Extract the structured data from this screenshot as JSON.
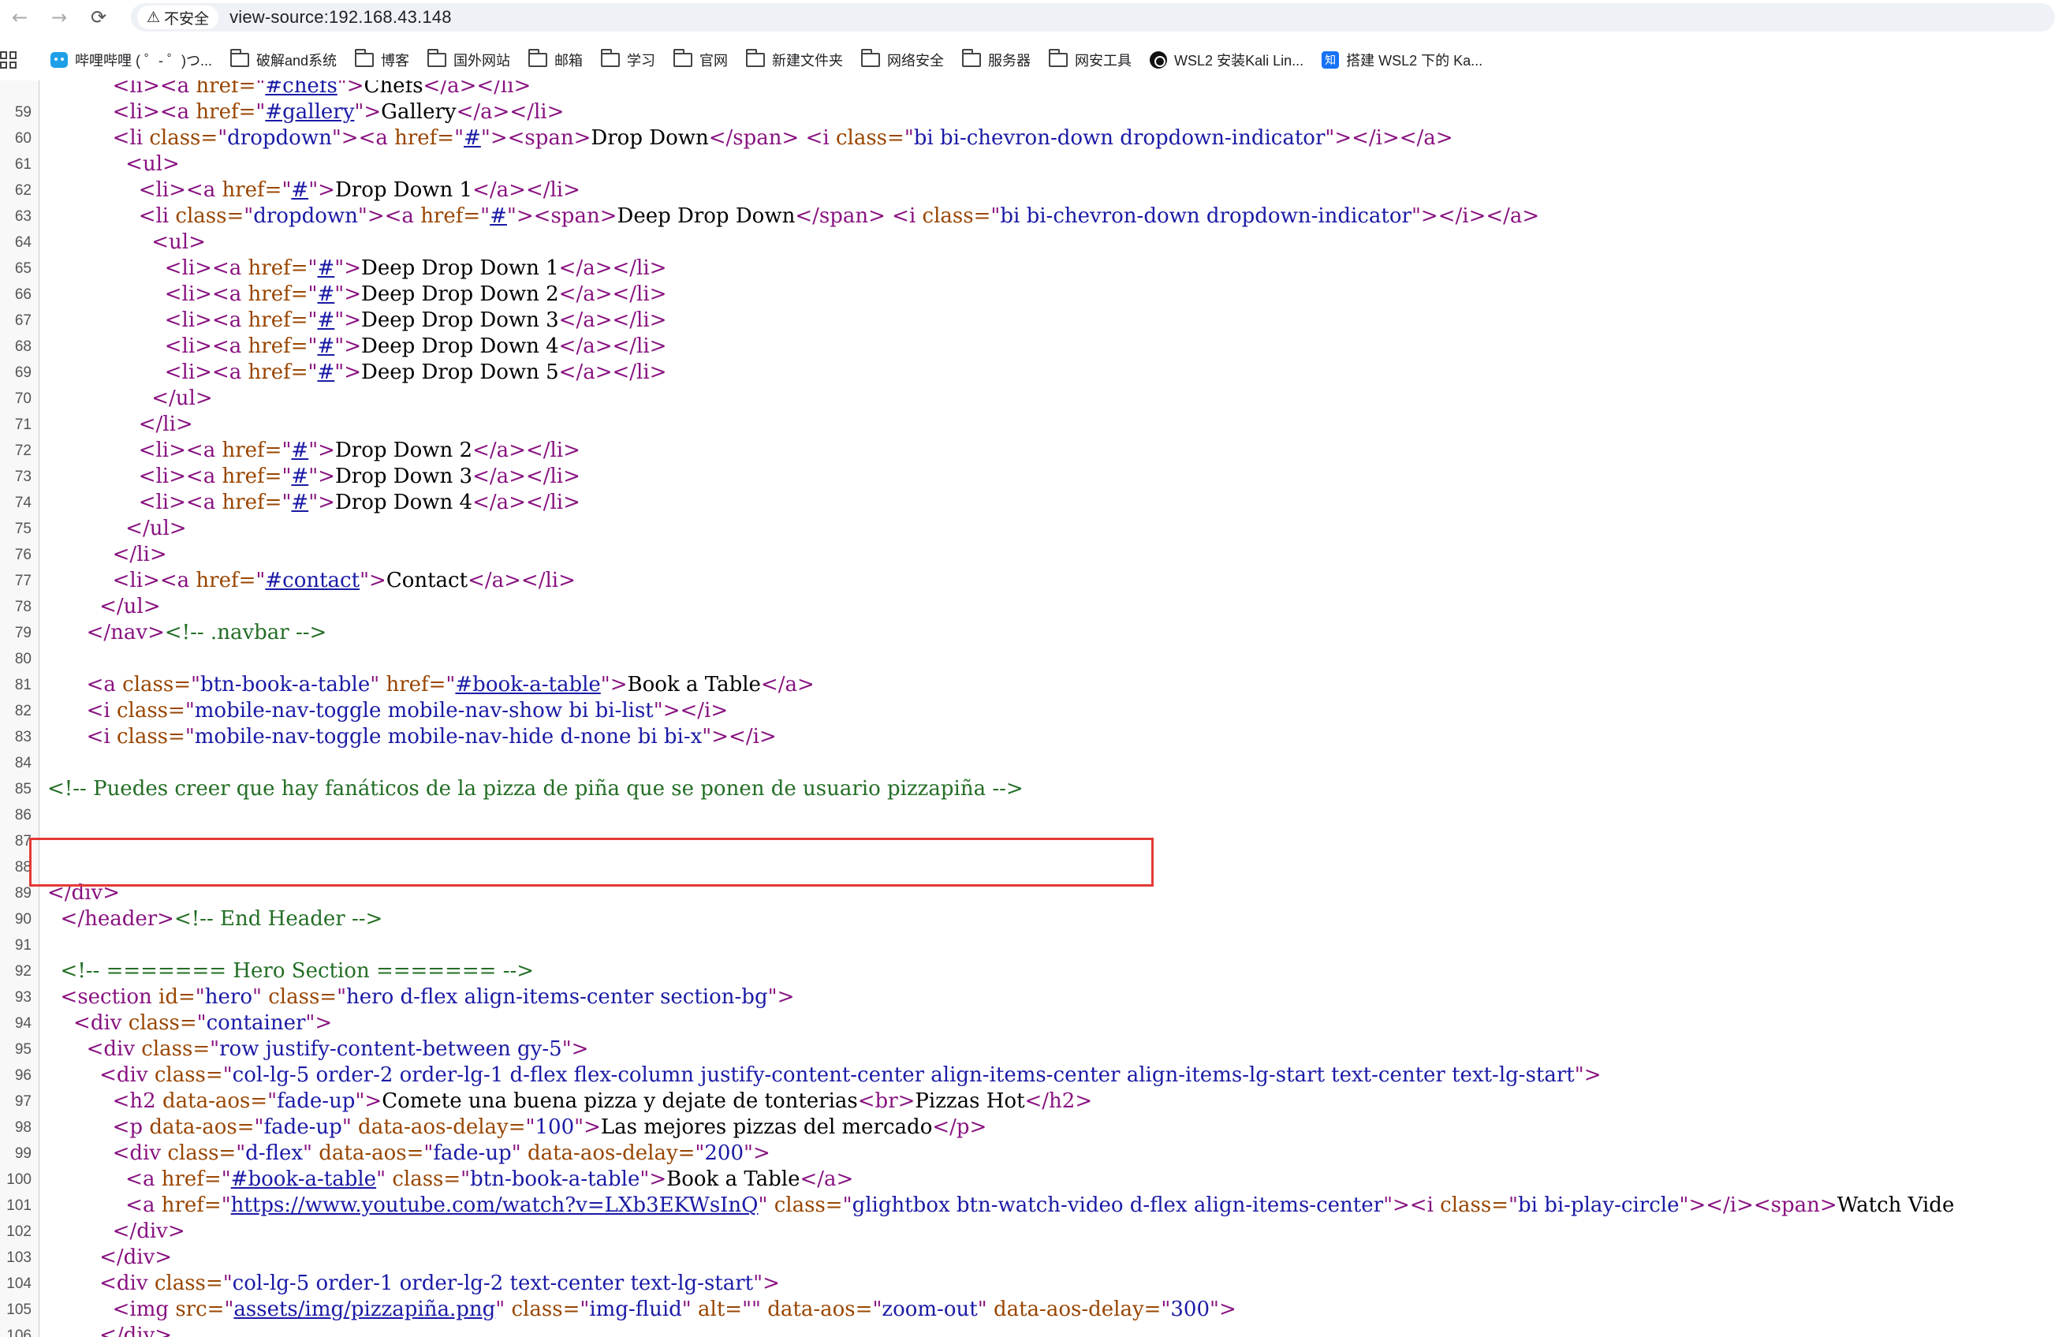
{
  "toolbar": {
    "back_icon": "←",
    "forward_icon": "→",
    "reload_icon": "⟳"
  },
  "address_bar": {
    "security_icon": "⚠",
    "security_label": "不安全",
    "url": "view-source:192.168.43.148"
  },
  "bookmarks": [
    {
      "label": "哔哩哔哩 ( ゜- ゜)つ...",
      "icon": "bilibili-icon"
    },
    {
      "label": "破解and系统",
      "icon": "folder-icon"
    },
    {
      "label": "博客",
      "icon": "folder-icon"
    },
    {
      "label": "国外网站",
      "icon": "folder-icon"
    },
    {
      "label": "邮箱",
      "icon": "folder-icon"
    },
    {
      "label": "学习",
      "icon": "folder-icon"
    },
    {
      "label": "官网",
      "icon": "folder-icon"
    },
    {
      "label": "新建文件夹",
      "icon": "folder-icon"
    },
    {
      "label": "网络安全",
      "icon": "folder-icon"
    },
    {
      "label": "服务器",
      "icon": "folder-icon"
    },
    {
      "label": "网安工具",
      "icon": "folder-icon"
    },
    {
      "label": "WSL2 安装Kali Lin...",
      "icon": "circle-icon"
    },
    {
      "label": "搭建 WSL2 下的 Ka...",
      "icon": "zhihu-icon"
    }
  ],
  "source_lines": [
    {
      "n": "",
      "seg": [
        [
          "t",
          "          <li><a "
        ],
        [
          "a",
          "href="
        ],
        [
          "t",
          "\""
        ],
        [
          "k",
          "#chefs"
        ],
        [
          "t",
          "\">"
        ],
        [
          "x",
          "Chefs"
        ],
        [
          "t",
          "</a></li>"
        ]
      ]
    },
    {
      "n": "59",
      "seg": [
        [
          "t",
          "          <li><a "
        ],
        [
          "a",
          "href="
        ],
        [
          "t",
          "\""
        ],
        [
          "k",
          "#gallery"
        ],
        [
          "t",
          "\">"
        ],
        [
          "x",
          "Gallery"
        ],
        [
          "t",
          "</a></li>"
        ]
      ]
    },
    {
      "n": "60",
      "seg": [
        [
          "t",
          "          <li "
        ],
        [
          "a",
          "class="
        ],
        [
          "t",
          "\""
        ],
        [
          "v",
          "dropdown"
        ],
        [
          "t",
          "\"><a "
        ],
        [
          "a",
          "href="
        ],
        [
          "t",
          "\""
        ],
        [
          "k",
          "#"
        ],
        [
          "t",
          "\"><span>"
        ],
        [
          "x",
          "Drop Down"
        ],
        [
          "t",
          "</span> <i "
        ],
        [
          "a",
          "class="
        ],
        [
          "t",
          "\""
        ],
        [
          "v",
          "bi bi-chevron-down dropdown-indicator"
        ],
        [
          "t",
          "\"></i></a>"
        ]
      ]
    },
    {
      "n": "61",
      "seg": [
        [
          "t",
          "            <ul>"
        ]
      ]
    },
    {
      "n": "62",
      "seg": [
        [
          "t",
          "              <li><a "
        ],
        [
          "a",
          "href="
        ],
        [
          "t",
          "\""
        ],
        [
          "k",
          "#"
        ],
        [
          "t",
          "\">"
        ],
        [
          "x",
          "Drop Down 1"
        ],
        [
          "t",
          "</a></li>"
        ]
      ]
    },
    {
      "n": "63",
      "seg": [
        [
          "t",
          "              <li "
        ],
        [
          "a",
          "class="
        ],
        [
          "t",
          "\""
        ],
        [
          "v",
          "dropdown"
        ],
        [
          "t",
          "\"><a "
        ],
        [
          "a",
          "href="
        ],
        [
          "t",
          "\""
        ],
        [
          "k",
          "#"
        ],
        [
          "t",
          "\"><span>"
        ],
        [
          "x",
          "Deep Drop Down"
        ],
        [
          "t",
          "</span> <i "
        ],
        [
          "a",
          "class="
        ],
        [
          "t",
          "\""
        ],
        [
          "v",
          "bi bi-chevron-down dropdown-indicator"
        ],
        [
          "t",
          "\"></i></a>"
        ]
      ]
    },
    {
      "n": "64",
      "seg": [
        [
          "t",
          "                <ul>"
        ]
      ]
    },
    {
      "n": "65",
      "seg": [
        [
          "t",
          "                  <li><a "
        ],
        [
          "a",
          "href="
        ],
        [
          "t",
          "\""
        ],
        [
          "k",
          "#"
        ],
        [
          "t",
          "\">"
        ],
        [
          "x",
          "Deep Drop Down 1"
        ],
        [
          "t",
          "</a></li>"
        ]
      ]
    },
    {
      "n": "66",
      "seg": [
        [
          "t",
          "                  <li><a "
        ],
        [
          "a",
          "href="
        ],
        [
          "t",
          "\""
        ],
        [
          "k",
          "#"
        ],
        [
          "t",
          "\">"
        ],
        [
          "x",
          "Deep Drop Down 2"
        ],
        [
          "t",
          "</a></li>"
        ]
      ]
    },
    {
      "n": "67",
      "seg": [
        [
          "t",
          "                  <li><a "
        ],
        [
          "a",
          "href="
        ],
        [
          "t",
          "\""
        ],
        [
          "k",
          "#"
        ],
        [
          "t",
          "\">"
        ],
        [
          "x",
          "Deep Drop Down 3"
        ],
        [
          "t",
          "</a></li>"
        ]
      ]
    },
    {
      "n": "68",
      "seg": [
        [
          "t",
          "                  <li><a "
        ],
        [
          "a",
          "href="
        ],
        [
          "t",
          "\""
        ],
        [
          "k",
          "#"
        ],
        [
          "t",
          "\">"
        ],
        [
          "x",
          "Deep Drop Down 4"
        ],
        [
          "t",
          "</a></li>"
        ]
      ]
    },
    {
      "n": "69",
      "seg": [
        [
          "t",
          "                  <li><a "
        ],
        [
          "a",
          "href="
        ],
        [
          "t",
          "\""
        ],
        [
          "k",
          "#"
        ],
        [
          "t",
          "\">"
        ],
        [
          "x",
          "Deep Drop Down 5"
        ],
        [
          "t",
          "</a></li>"
        ]
      ]
    },
    {
      "n": "70",
      "seg": [
        [
          "t",
          "                </ul>"
        ]
      ]
    },
    {
      "n": "71",
      "seg": [
        [
          "t",
          "              </li>"
        ]
      ]
    },
    {
      "n": "72",
      "seg": [
        [
          "t",
          "              <li><a "
        ],
        [
          "a",
          "href="
        ],
        [
          "t",
          "\""
        ],
        [
          "k",
          "#"
        ],
        [
          "t",
          "\">"
        ],
        [
          "x",
          "Drop Down 2"
        ],
        [
          "t",
          "</a></li>"
        ]
      ]
    },
    {
      "n": "73",
      "seg": [
        [
          "t",
          "              <li><a "
        ],
        [
          "a",
          "href="
        ],
        [
          "t",
          "\""
        ],
        [
          "k",
          "#"
        ],
        [
          "t",
          "\">"
        ],
        [
          "x",
          "Drop Down 3"
        ],
        [
          "t",
          "</a></li>"
        ]
      ]
    },
    {
      "n": "74",
      "seg": [
        [
          "t",
          "              <li><a "
        ],
        [
          "a",
          "href="
        ],
        [
          "t",
          "\""
        ],
        [
          "k",
          "#"
        ],
        [
          "t",
          "\">"
        ],
        [
          "x",
          "Drop Down 4"
        ],
        [
          "t",
          "</a></li>"
        ]
      ]
    },
    {
      "n": "75",
      "seg": [
        [
          "t",
          "            </ul>"
        ]
      ]
    },
    {
      "n": "76",
      "seg": [
        [
          "t",
          "          </li>"
        ]
      ]
    },
    {
      "n": "77",
      "seg": [
        [
          "t",
          "          <li><a "
        ],
        [
          "a",
          "href="
        ],
        [
          "t",
          "\""
        ],
        [
          "k",
          "#contact"
        ],
        [
          "t",
          "\">"
        ],
        [
          "x",
          "Contact"
        ],
        [
          "t",
          "</a></li>"
        ]
      ]
    },
    {
      "n": "78",
      "seg": [
        [
          "t",
          "        </ul>"
        ]
      ]
    },
    {
      "n": "79",
      "seg": [
        [
          "t",
          "      </nav>"
        ],
        [
          "c",
          "<!-- .navbar -->"
        ]
      ]
    },
    {
      "n": "80",
      "seg": []
    },
    {
      "n": "81",
      "seg": [
        [
          "t",
          "      <a "
        ],
        [
          "a",
          "class="
        ],
        [
          "t",
          "\""
        ],
        [
          "v",
          "btn-book-a-table"
        ],
        [
          "t",
          "\" "
        ],
        [
          "a",
          "href="
        ],
        [
          "t",
          "\""
        ],
        [
          "k",
          "#book-a-table"
        ],
        [
          "t",
          "\">"
        ],
        [
          "x",
          "Book a Table"
        ],
        [
          "t",
          "</a>"
        ]
      ]
    },
    {
      "n": "82",
      "seg": [
        [
          "t",
          "      <i "
        ],
        [
          "a",
          "class="
        ],
        [
          "t",
          "\""
        ],
        [
          "v",
          "mobile-nav-toggle mobile-nav-show bi bi-list"
        ],
        [
          "t",
          "\"></i>"
        ]
      ]
    },
    {
      "n": "83",
      "seg": [
        [
          "t",
          "      <i "
        ],
        [
          "a",
          "class="
        ],
        [
          "t",
          "\""
        ],
        [
          "v",
          "mobile-nav-toggle mobile-nav-hide d-none bi bi-x"
        ],
        [
          "t",
          "\"></i>"
        ]
      ]
    },
    {
      "n": "84",
      "seg": []
    },
    {
      "n": "85",
      "seg": [
        [
          "c",
          "<!-- Puedes creer que hay fanáticos de la pizza de piña que se ponen de usuario pizzapiña -->"
        ]
      ]
    },
    {
      "n": "86",
      "seg": []
    },
    {
      "n": "87",
      "seg": []
    },
    {
      "n": "88",
      "seg": []
    },
    {
      "n": "89",
      "seg": [
        [
          "t",
          "</div>"
        ]
      ]
    },
    {
      "n": "90",
      "seg": [
        [
          "t",
          "  </header>"
        ],
        [
          "c",
          "<!-- End Header -->"
        ]
      ]
    },
    {
      "n": "91",
      "seg": []
    },
    {
      "n": "92",
      "seg": [
        [
          "c",
          "  <!-- ======= Hero Section ======= -->"
        ]
      ]
    },
    {
      "n": "93",
      "seg": [
        [
          "t",
          "  <section "
        ],
        [
          "a",
          "id="
        ],
        [
          "t",
          "\""
        ],
        [
          "v",
          "hero"
        ],
        [
          "t",
          "\" "
        ],
        [
          "a",
          "class="
        ],
        [
          "t",
          "\""
        ],
        [
          "v",
          "hero d-flex align-items-center section-bg"
        ],
        [
          "t",
          "\">"
        ]
      ]
    },
    {
      "n": "94",
      "seg": [
        [
          "t",
          "    <div "
        ],
        [
          "a",
          "class="
        ],
        [
          "t",
          "\""
        ],
        [
          "v",
          "container"
        ],
        [
          "t",
          "\">"
        ]
      ]
    },
    {
      "n": "95",
      "seg": [
        [
          "t",
          "      <div "
        ],
        [
          "a",
          "class="
        ],
        [
          "t",
          "\""
        ],
        [
          "v",
          "row justify-content-between gy-5"
        ],
        [
          "t",
          "\">"
        ]
      ]
    },
    {
      "n": "96",
      "seg": [
        [
          "t",
          "        <div "
        ],
        [
          "a",
          "class="
        ],
        [
          "t",
          "\""
        ],
        [
          "v",
          "col-lg-5 order-2 order-lg-1 d-flex flex-column justify-content-center align-items-center align-items-lg-start text-center text-lg-start"
        ],
        [
          "t",
          "\">"
        ]
      ]
    },
    {
      "n": "97",
      "seg": [
        [
          "t",
          "          <h2 "
        ],
        [
          "a",
          "data-aos="
        ],
        [
          "t",
          "\""
        ],
        [
          "v",
          "fade-up"
        ],
        [
          "t",
          "\">"
        ],
        [
          "x",
          "Comete una buena pizza y dejate de tonterias"
        ],
        [
          "t",
          "<br>"
        ],
        [
          "x",
          "Pizzas Hot"
        ],
        [
          "t",
          "</h2>"
        ]
      ]
    },
    {
      "n": "98",
      "seg": [
        [
          "t",
          "          <p "
        ],
        [
          "a",
          "data-aos="
        ],
        [
          "t",
          "\""
        ],
        [
          "v",
          "fade-up"
        ],
        [
          "t",
          "\" "
        ],
        [
          "a",
          "data-aos-delay="
        ],
        [
          "t",
          "\""
        ],
        [
          "v",
          "100"
        ],
        [
          "t",
          "\">"
        ],
        [
          "x",
          "Las mejores pizzas del mercado"
        ],
        [
          "t",
          "</p>"
        ]
      ]
    },
    {
      "n": "99",
      "seg": [
        [
          "t",
          "          <div "
        ],
        [
          "a",
          "class="
        ],
        [
          "t",
          "\""
        ],
        [
          "v",
          "d-flex"
        ],
        [
          "t",
          "\" "
        ],
        [
          "a",
          "data-aos="
        ],
        [
          "t",
          "\""
        ],
        [
          "v",
          "fade-up"
        ],
        [
          "t",
          "\" "
        ],
        [
          "a",
          "data-aos-delay="
        ],
        [
          "t",
          "\""
        ],
        [
          "v",
          "200"
        ],
        [
          "t",
          "\">"
        ]
      ]
    },
    {
      "n": "100",
      "seg": [
        [
          "t",
          "            <a "
        ],
        [
          "a",
          "href="
        ],
        [
          "t",
          "\""
        ],
        [
          "k",
          "#book-a-table"
        ],
        [
          "t",
          "\" "
        ],
        [
          "a",
          "class="
        ],
        [
          "t",
          "\""
        ],
        [
          "v",
          "btn-book-a-table"
        ],
        [
          "t",
          "\">"
        ],
        [
          "x",
          "Book a Table"
        ],
        [
          "t",
          "</a>"
        ]
      ]
    },
    {
      "n": "101",
      "seg": [
        [
          "t",
          "            <a "
        ],
        [
          "a",
          "href="
        ],
        [
          "t",
          "\""
        ],
        [
          "k",
          "https://www.youtube.com/watch?v=LXb3EKWsInQ"
        ],
        [
          "t",
          "\" "
        ],
        [
          "a",
          "class="
        ],
        [
          "t",
          "\""
        ],
        [
          "v",
          "glightbox btn-watch-video d-flex align-items-center"
        ],
        [
          "t",
          "\"><i "
        ],
        [
          "a",
          "class="
        ],
        [
          "t",
          "\""
        ],
        [
          "v",
          "bi bi-play-circle"
        ],
        [
          "t",
          "\"></i><span>"
        ],
        [
          "x",
          "Watch Vide"
        ]
      ]
    },
    {
      "n": "102",
      "seg": [
        [
          "t",
          "          </div>"
        ]
      ]
    },
    {
      "n": "103",
      "seg": [
        [
          "t",
          "        </div>"
        ]
      ]
    },
    {
      "n": "104",
      "seg": [
        [
          "t",
          "        <div "
        ],
        [
          "a",
          "class="
        ],
        [
          "t",
          "\""
        ],
        [
          "v",
          "col-lg-5 order-1 order-lg-2 text-center text-lg-start"
        ],
        [
          "t",
          "\">"
        ]
      ]
    },
    {
      "n": "105",
      "seg": [
        [
          "t",
          "          <img "
        ],
        [
          "a",
          "src="
        ],
        [
          "t",
          "\""
        ],
        [
          "k",
          "assets/img/pizzapiña.png"
        ],
        [
          "t",
          "\" "
        ],
        [
          "a",
          "class="
        ],
        [
          "t",
          "\""
        ],
        [
          "v",
          "img-fluid"
        ],
        [
          "t",
          "\" "
        ],
        [
          "a",
          "alt="
        ],
        [
          "t",
          "\"\" "
        ],
        [
          "a",
          "data-aos="
        ],
        [
          "t",
          "\""
        ],
        [
          "v",
          "zoom-out"
        ],
        [
          "t",
          "\" "
        ],
        [
          "a",
          "data-aos-delay="
        ],
        [
          "t",
          "\""
        ],
        [
          "v",
          "300"
        ],
        [
          "t",
          "\">"
        ]
      ]
    },
    {
      "n": "106",
      "seg": [
        [
          "t",
          "        </div>"
        ]
      ]
    }
  ]
}
